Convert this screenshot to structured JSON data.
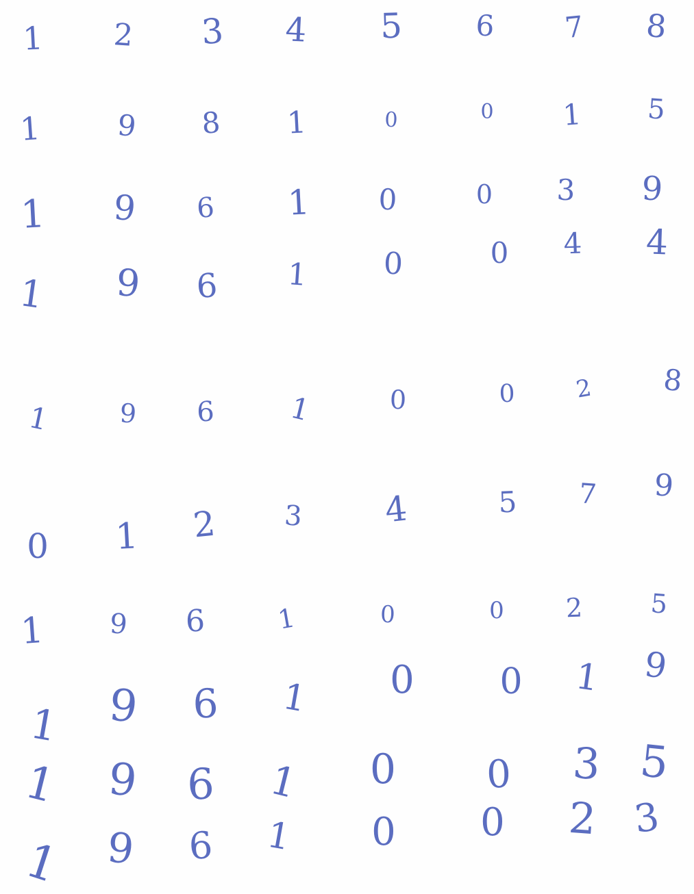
{
  "page": {
    "ink_color": "#5b6dc0",
    "paper_color": "#fefefe"
  },
  "rows": [
    [
      "1",
      "2",
      "3",
      "4",
      "5",
      "6",
      "7",
      "8"
    ],
    [
      "1",
      "9",
      "8",
      "1",
      "0",
      "0",
      "1",
      "5"
    ],
    [
      "1",
      "9",
      "6",
      "1",
      "0",
      "0",
      "3",
      "9"
    ],
    [
      "1",
      "9",
      "6",
      "1",
      "0",
      "0",
      "4",
      "4"
    ],
    [
      "1",
      "9",
      "6",
      "1",
      "0",
      "0",
      "2",
      "8"
    ],
    [
      "0",
      "1",
      "2",
      "3",
      "4",
      "5",
      "7",
      "9"
    ],
    [
      "1",
      "9",
      "6",
      "1",
      "0",
      "0",
      "2",
      "5"
    ],
    [
      "1",
      "9",
      "6",
      "1",
      "0",
      "0",
      "1",
      "9"
    ],
    [
      "1",
      "9",
      "6",
      "1",
      "0",
      "0",
      "3",
      "5"
    ],
    [
      "1",
      "9",
      "6",
      "1",
      "0",
      "0",
      "2",
      "3"
    ]
  ]
}
